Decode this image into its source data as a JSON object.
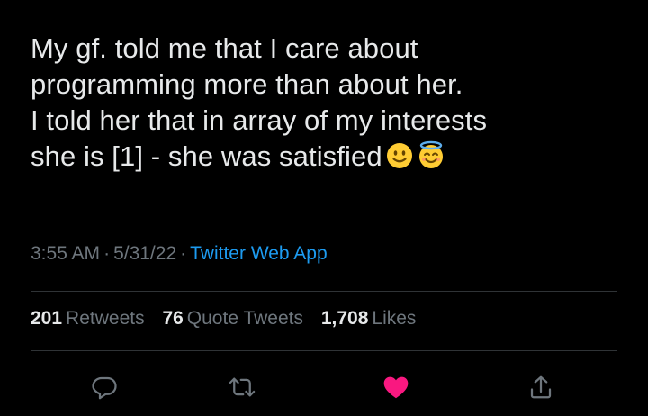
{
  "tweet": {
    "lines": [
      "My gf. told me that I care about",
      "programming more than about her.",
      "I told her that in array of my interests",
      "she is [1] - she was satisfied"
    ],
    "emojis": [
      "slightly-smiling-face-icon",
      "smiling-face-with-halo-icon"
    ]
  },
  "meta": {
    "time": "3:55 AM",
    "separator": "·",
    "date": "5/31/22",
    "app": "Twitter Web App"
  },
  "stats": {
    "retweets_count": "201",
    "retweets_label": "Retweets",
    "quotes_count": "76",
    "quotes_label": "Quote Tweets",
    "likes_count": "1,708",
    "likes_label": "Likes"
  },
  "actions": {
    "icons": [
      "reply-icon",
      "retweet-icon",
      "like-icon",
      "share-icon"
    ],
    "liked": true
  },
  "colors": {
    "background": "#000000",
    "text": "#e7e9ea",
    "muted": "#6e767d",
    "link": "#1d9bf0",
    "like": "#f91880",
    "divider": "#2f3336"
  }
}
